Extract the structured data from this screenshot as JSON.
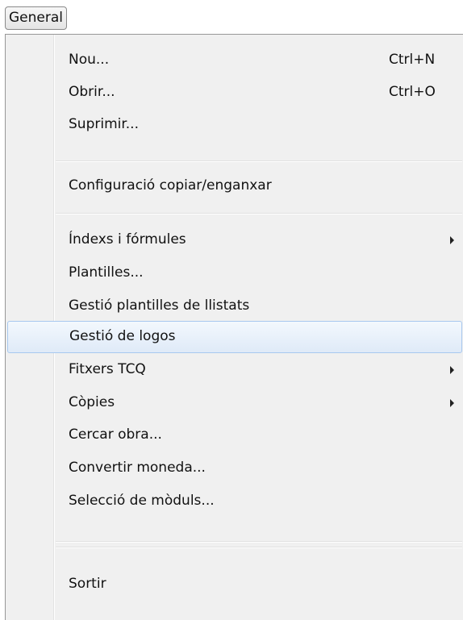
{
  "menubar": {
    "general_label": "General"
  },
  "menu": {
    "items": [
      {
        "label": "Nou...",
        "shortcut": "Ctrl+N"
      },
      {
        "label": "Obrir...",
        "shortcut": "Ctrl+O"
      },
      {
        "label": "Suprimir..."
      },
      {
        "label": "Configuració copiar/enganxar"
      },
      {
        "label": "Índexs i fórmules",
        "submenu": true
      },
      {
        "label": "Plantilles..."
      },
      {
        "label": "Gestió plantilles de llistats"
      },
      {
        "label": "Gestió de logos",
        "highlighted": true
      },
      {
        "label": "Fitxers TCQ",
        "submenu": true
      },
      {
        "label": "Còpies",
        "submenu": true
      },
      {
        "label": "Cercar obra..."
      },
      {
        "label": "Convertir moneda..."
      },
      {
        "label": "Selecció de mòduls..."
      },
      {
        "label": "Sortir"
      }
    ]
  },
  "colors": {
    "highlight_border": "#a8c8ef",
    "menu_background": "#f0f0f0"
  }
}
